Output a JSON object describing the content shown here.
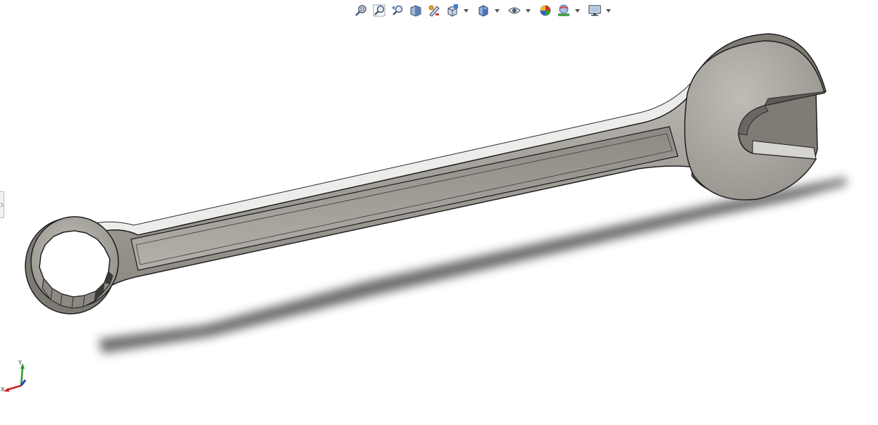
{
  "toolbar": {
    "buttons": [
      {
        "id": "zoom-to-fit",
        "icon": "zoom-to-fit-icon"
      },
      {
        "id": "zoom-to-area",
        "icon": "zoom-to-area-icon"
      },
      {
        "id": "previous-view",
        "icon": "previous-view-icon"
      },
      {
        "id": "section-view",
        "icon": "section-view-icon"
      },
      {
        "id": "dynamic-annotation-views",
        "icon": "dynamic-annotation-icon"
      },
      {
        "id": "view-orientation",
        "icon": "view-orientation-icon",
        "dropdown": true
      },
      {
        "id": "display-style",
        "icon": "display-style-icon",
        "dropdown": true
      },
      {
        "id": "hide-show-items",
        "icon": "eye-icon",
        "dropdown": true
      },
      {
        "id": "edit-appearance",
        "icon": "edit-appearance-icon"
      },
      {
        "id": "apply-scene",
        "icon": "apply-scene-icon",
        "dropdown": true
      },
      {
        "id": "view-settings",
        "icon": "monitor-icon",
        "dropdown": true
      }
    ]
  },
  "triad": {
    "x_label": "X",
    "y_label": "Y",
    "x_color": "#d22020",
    "y_color": "#2a9a2a",
    "z_color": "#2040d0"
  },
  "model": {
    "color_body": "#a8a59f",
    "color_dark": "#6f6c66",
    "color_light": "#d8d6d1",
    "shadow_color": "#505050"
  }
}
